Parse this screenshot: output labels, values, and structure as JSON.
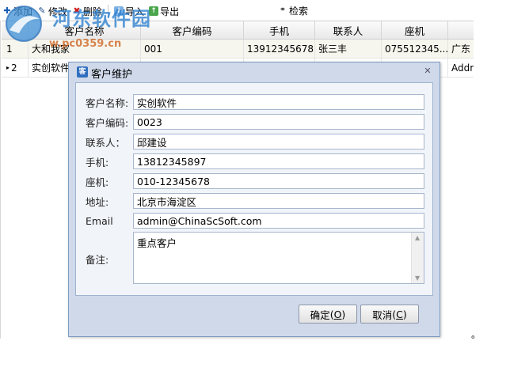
{
  "toolbar": {
    "add": "添加",
    "edit": "修改",
    "delete": "删除",
    "import": "导入",
    "export": "导出",
    "search": "检索"
  },
  "watermark": {
    "text": "河东软件园",
    "url": "w.pc0359.cn"
  },
  "grid": {
    "headers": [
      "客户名称",
      "客户编码",
      "手机",
      "联系人",
      "座机"
    ],
    "rows": [
      {
        "index": "1",
        "name": "大和我家",
        "code": "001",
        "mobile": "13912345678",
        "contact": "张三丰",
        "phone": "075512345...",
        "address": "广东"
      },
      {
        "index": "2",
        "name": "实创软件",
        "code": "",
        "mobile": "",
        "contact": "",
        "phone": "",
        "address": "Addr"
      }
    ]
  },
  "dialog": {
    "title": "客户维护",
    "fields": {
      "name": {
        "label": "客户名称:",
        "value": "实创软件"
      },
      "code": {
        "label": "客户编码:",
        "value": "0023"
      },
      "contact": {
        "label": "联系人：",
        "value": "邱建设"
      },
      "mobile": {
        "label": "手机:",
        "value": "13812345897"
      },
      "phone": {
        "label": "座机:",
        "value": "010-12345678"
      },
      "address": {
        "label": "地址:",
        "value": "北京市海淀区"
      },
      "email": {
        "label": "Email",
        "value": "admin@ChinaScSoft.com"
      },
      "note": {
        "label": "备注:",
        "value": "重点客户"
      }
    },
    "ok_label": "确定",
    "ok_key": "O",
    "cancel_label": "取消",
    "cancel_key": "C"
  },
  "trailing_mark": "。",
  "colors": {
    "dialog_bg": "#cfd9ea",
    "form_bg": "#f1f4f9",
    "accent": "#2f6fbe"
  }
}
